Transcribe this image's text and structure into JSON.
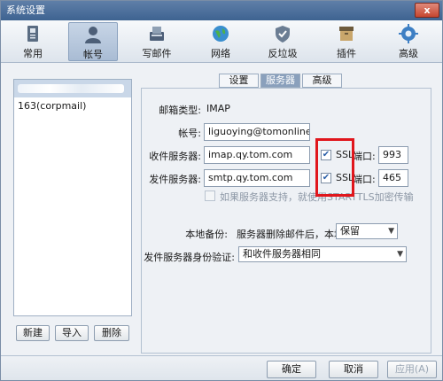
{
  "window": {
    "title": "系统设置",
    "close_label": "x"
  },
  "toolbar": {
    "items": [
      {
        "label": "常用",
        "icon": "general-icon"
      },
      {
        "label": "帐号",
        "icon": "account-icon",
        "active": true
      },
      {
        "label": "写邮件",
        "icon": "compose-icon"
      },
      {
        "label": "网络",
        "icon": "network-icon"
      },
      {
        "label": "反垃圾",
        "icon": "antispam-icon"
      },
      {
        "label": "插件",
        "icon": "plugin-icon"
      },
      {
        "label": "高级",
        "icon": "advanced-icon"
      }
    ]
  },
  "accounts": {
    "items": [
      {
        "label": "163(corpmail)"
      }
    ],
    "new_label": "新建",
    "import_label": "导入",
    "delete_label": "删除"
  },
  "tabs": [
    {
      "label": "设置"
    },
    {
      "label": "服务器",
      "active": true
    },
    {
      "label": "高级"
    }
  ],
  "server": {
    "mailbox_type_label": "邮箱类型:",
    "mailbox_type_value": "IMAP",
    "account_label": "帐号:",
    "account_value": "liguoying@tomonline-in",
    "incoming_label": "收件服务器:",
    "incoming_value": "imap.qy.tom.com",
    "incoming_ssl_label": "SSL",
    "incoming_port_label": "端口:",
    "incoming_port_value": "993",
    "outgoing_label": "发件服务器:",
    "outgoing_value": "smtp.qy.tom.com",
    "outgoing_ssl_label": "SSL",
    "outgoing_port_label": "端口:",
    "outgoing_port_value": "465",
    "starttls_label": "如果服务器支持，就使用STARTTLS加密传输",
    "backup_label": "本地备份:",
    "backup_desc": "服务器删除邮件后，本地",
    "backup_value": "保留",
    "auth_label": "发件服务器身份验证:",
    "auth_value": "和收件服务器相同"
  },
  "footer": {
    "ok_label": "确定",
    "cancel_label": "取消",
    "apply_label": "应用(A)"
  },
  "colors": {
    "accent": "#8aa0bc",
    "highlight_box": "#e0161c",
    "titlebar": "#4a6e9c"
  }
}
